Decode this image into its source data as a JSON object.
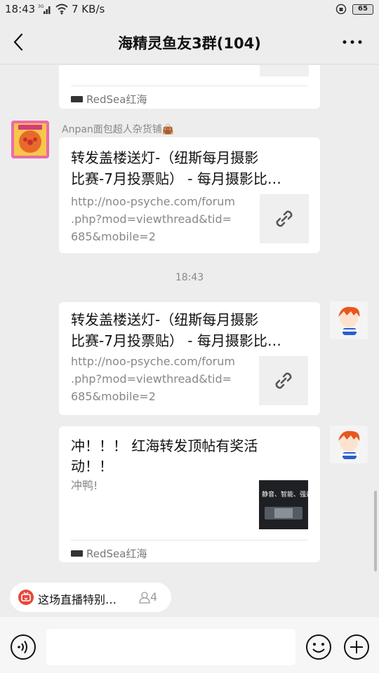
{
  "status": {
    "time": "18:43",
    "speed": "7 KB/s",
    "battery": "65"
  },
  "header": {
    "title": "海精灵鱼友3群(104)"
  },
  "messages": [
    {
      "type": "card-partial",
      "footer": "RedSea红海"
    },
    {
      "type": "link",
      "sender": "Anpan面包超人杂货铺👜",
      "title_line1": "转发盖楼送灯-（纽斯每月摄影",
      "title_line2": "比赛-7月投票贴） - 每月摄影比…",
      "url_line1": "http://noo-psyche.com/forum",
      "url_line2": ".php?mod=viewthread&tid=",
      "url_line3": "685&mobile=2"
    },
    {
      "type": "time",
      "time": "18:43"
    },
    {
      "type": "link-self",
      "title_line1": "转发盖楼送灯-（纽斯每月摄影",
      "title_line2": "比赛-7月投票贴） - 每月摄影比…",
      "url_line1": "http://noo-psyche.com/forum",
      "url_line2": ".php?mod=viewthread&tid=",
      "url_line3": "685&mobile=2"
    },
    {
      "type": "app-card-self",
      "title_line1": "冲！！！ 红海转发顶帖有奖活",
      "title_line2": "动！！",
      "desc": "冲鸭!",
      "thumb_text": "静音、智能、强劲",
      "footer": "RedSea红海"
    }
  ],
  "live": {
    "label": "这场直播特别…",
    "count": "4"
  },
  "icons": {
    "back": "back-arrow-icon",
    "more": "more-dots-icon",
    "link": "link-chain-icon",
    "voice": "voice-icon",
    "emoji": "emoji-icon",
    "plus": "plus-icon",
    "live": "live-tv-icon",
    "person": "person-icon"
  },
  "colors": {
    "background": "#ededed",
    "card": "#ffffff",
    "live_icon": "#e8473b"
  }
}
